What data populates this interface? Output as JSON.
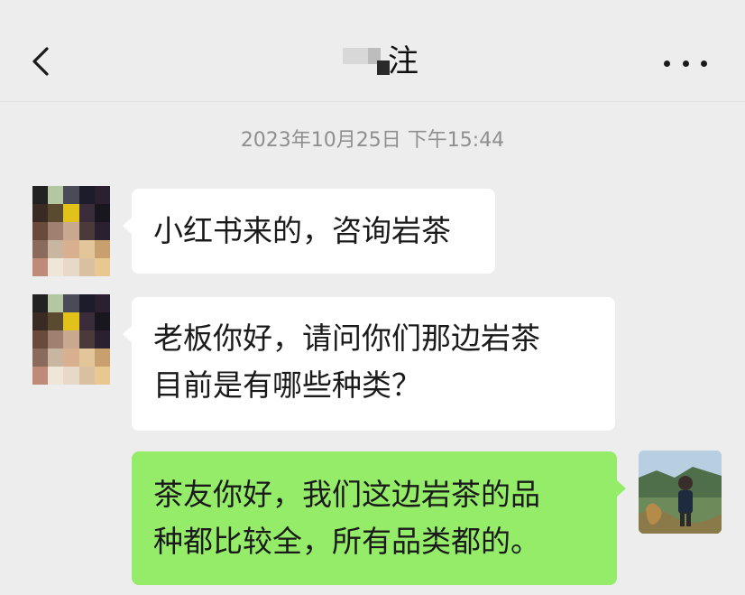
{
  "header": {
    "title": "注",
    "back_icon": "chevron-left-icon",
    "more_icon": "more-dots-icon"
  },
  "timestamp": "2023年10月25日 下午15:44",
  "messages": [
    {
      "direction": "incoming",
      "lines": [
        "小红书来的，咨询岩茶"
      ]
    },
    {
      "direction": "incoming",
      "lines": [
        "老板你好，请问你们那边岩茶",
        "目前是有哪些种类？"
      ]
    },
    {
      "direction": "outgoing",
      "lines": [
        "茶友你好，我们这边岩茶的品",
        "种都比较全，所有品类都的。"
      ]
    }
  ],
  "colors": {
    "background": "#ededed",
    "incoming_bubble": "#ffffff",
    "outgoing_bubble": "#95ec69",
    "timestamp": "#8f8f8f"
  }
}
